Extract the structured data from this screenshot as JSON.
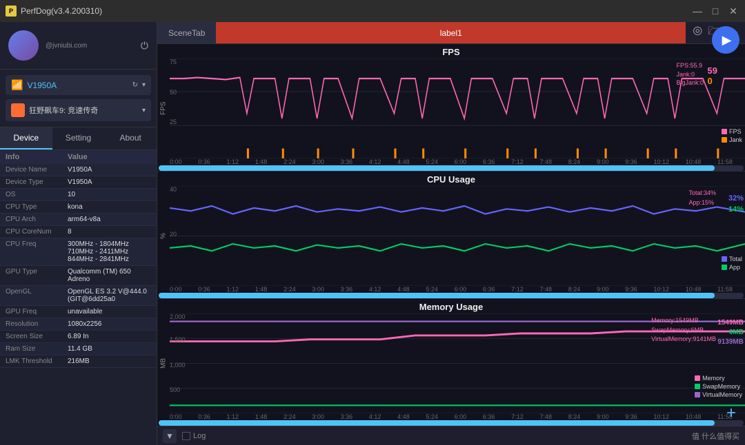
{
  "titleBar": {
    "title": "PerfDog(v3.4.200310)",
    "controls": [
      "—",
      "□",
      "✕"
    ]
  },
  "sidebar": {
    "profile": {
      "email": "@jvniubi.com",
      "powerIcon": "⏻"
    },
    "device": {
      "name": "V1950A",
      "refreshIcon": "↻",
      "arrowIcon": "▾"
    },
    "game": {
      "name": "狂野飙车9: 竞速传奇",
      "arrowIcon": "▾"
    },
    "tabs": [
      "Device",
      "Setting",
      "About"
    ],
    "activeTab": "Device",
    "infoHeader": [
      "Info",
      "Value"
    ],
    "infoRows": [
      [
        "Device Name",
        "V1950A"
      ],
      [
        "Device Type",
        "V1950A"
      ],
      [
        "OS",
        "10"
      ],
      [
        "CPU Type",
        "kona"
      ],
      [
        "CPU Arch",
        "arm64-v8a"
      ],
      [
        "CPU CoreNum",
        "8"
      ],
      [
        "CPU Freq",
        "300MHz - 1804MHz 710MHz - 2411MHz 844MHz - 2841MHz"
      ],
      [
        "GPU Type",
        "Qualcomm (TM) 650 Adreno"
      ],
      [
        "OpenGL",
        "OpenGL ES 3.2 V@444.0 (GIT@6dd25a0"
      ],
      [
        "GPU Freq",
        "unavailable"
      ],
      [
        "Resolution",
        "1080x2256"
      ],
      [
        "Screen Size",
        "6.89 In"
      ],
      [
        "Ram Size",
        "11.4 GB"
      ],
      [
        "LMK Threshold",
        "216MB"
      ]
    ]
  },
  "topBar": {
    "sceneTabLabel": "SceneTab",
    "labelTabLabel": "label1",
    "icons": [
      "◎",
      "🗁",
      "☁"
    ]
  },
  "charts": {
    "fps": {
      "title": "FPS",
      "yLabel": "FPS",
      "yMax": 75,
      "yMid": 50,
      "yLow": 25,
      "overlay": "FPS:55.9\nJank:0\nBigJank:0",
      "valueRight1": "59",
      "valueRight2": "0",
      "legend": [
        {
          "color": "#ff69b4",
          "label": "FPS"
        },
        {
          "color": "#ff8c00",
          "label": "Jank"
        }
      ],
      "xTicks": [
        "0:00",
        "0:36",
        "1:12",
        "1:48",
        "2:24",
        "3:00",
        "3:36",
        "4:12",
        "4:48",
        "5:24",
        "6:00",
        "6:36",
        "7:12",
        "7:48",
        "8:24",
        "9:00",
        "9:36",
        "10:12",
        "10:48",
        "11:58"
      ]
    },
    "cpu": {
      "title": "CPU Usage",
      "yLabel": "%",
      "yMax": 40,
      "yMid": 20,
      "overlay": "Total:34%\nApp:15%",
      "valueRight1": "32%",
      "valueRight2": "14%",
      "legend": [
        {
          "color": "#6666ff",
          "label": "Total"
        },
        {
          "color": "#00cc66",
          "label": "App"
        }
      ],
      "xTicks": [
        "0:00",
        "0:36",
        "1:12",
        "1:48",
        "2:24",
        "3:00",
        "3:36",
        "4:12",
        "4:48",
        "5:24",
        "6:00",
        "6:36",
        "7:12",
        "7:48",
        "8:24",
        "9:00",
        "9:36",
        "10:12",
        "10:48",
        "11:58"
      ]
    },
    "memory": {
      "title": "Memory Usage",
      "yLabel": "MB",
      "yMax": 2000,
      "yMid": 1500,
      "yLow": 1000,
      "yLowest": 500,
      "overlay": "Memory:1549MB\nSwapMemory:6MB\nVirtualMemory:9141MB",
      "valueRight1": "1549MB",
      "valueRight2": "6MB",
      "valueRight3": "9139MB",
      "legend": [
        {
          "color": "#ff69b4",
          "label": "Memory"
        },
        {
          "color": "#00cc66",
          "label": "SwapMemory"
        },
        {
          "color": "#9966cc",
          "label": "VirtualMemory"
        }
      ],
      "xTicks": [
        "0:00",
        "0:36",
        "1:12",
        "1:48",
        "2:24",
        "3:00",
        "3:36",
        "4:12",
        "4:48",
        "5:24",
        "6:00",
        "6:36",
        "7:12",
        "7:48",
        "8:24",
        "9:00",
        "9:36",
        "10:12",
        "10:48",
        "11:58"
      ]
    }
  },
  "bottomBar": {
    "downArrow": "▼",
    "logLabel": "Log",
    "watermark": "值 什么值得买"
  },
  "playButton": "▶"
}
